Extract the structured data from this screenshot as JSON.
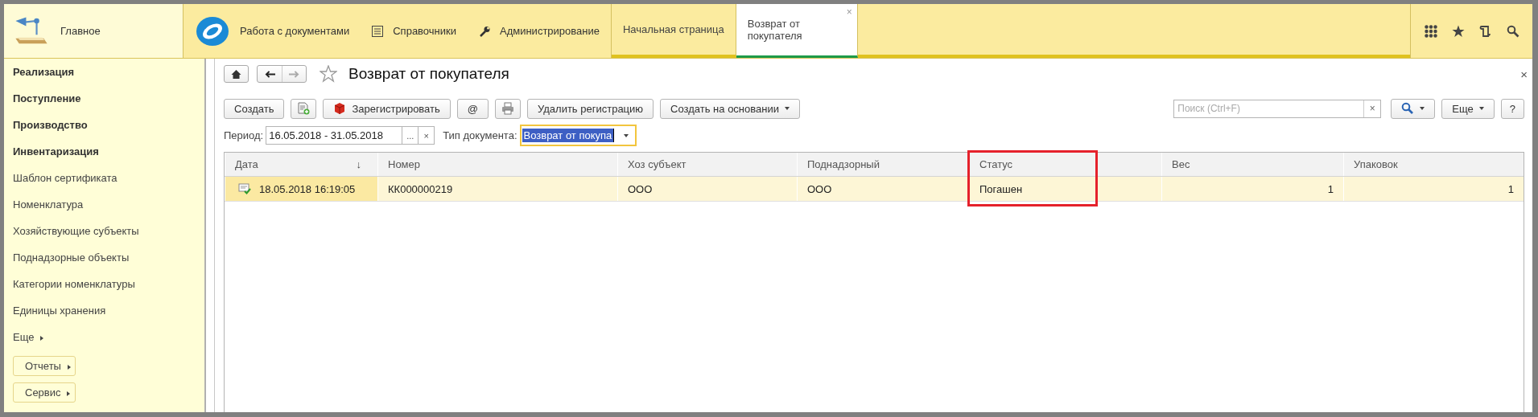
{
  "top_bar": {
    "home": {
      "label": "Главное"
    },
    "sections": [
      {
        "kind": "logo",
        "label": "Работа с документами"
      },
      {
        "kind": "list",
        "label": "Справочники"
      },
      {
        "kind": "wrench",
        "label": "Администрирование"
      }
    ],
    "open_tabs": [
      {
        "label": "Начальная страница",
        "selected": false
      },
      {
        "label": "Возврат от покупателя",
        "selected": true,
        "close": "×"
      }
    ]
  },
  "sidebar": {
    "items": [
      {
        "kind": "section",
        "label": "Реализация"
      },
      {
        "kind": "section",
        "label": "Поступление"
      },
      {
        "kind": "section",
        "label": "Производство"
      },
      {
        "kind": "section",
        "label": "Инвентаризация"
      },
      {
        "kind": "command",
        "label": "Шаблон сертификата"
      },
      {
        "kind": "command",
        "label": "Номенклатура"
      },
      {
        "kind": "command",
        "label": "Хозяйствующие субъекты"
      },
      {
        "kind": "command",
        "label": "Поднадзорные объекты"
      },
      {
        "kind": "command",
        "label": "Категории номенклатуры"
      },
      {
        "kind": "command",
        "label": "Единицы хранения"
      },
      {
        "kind": "more",
        "label": "Еще"
      }
    ],
    "buttons": [
      "Отчеты",
      "Сервис"
    ]
  },
  "form": {
    "title": "Возврат от покупателя",
    "close": "×",
    "toolbar": [
      {
        "kind": "text",
        "label": "Создать"
      },
      {
        "kind": "add-doc"
      },
      {
        "kind": "cube",
        "label": "Зарегистрировать"
      },
      {
        "kind": "text",
        "label": "@"
      },
      {
        "kind": "printer"
      },
      {
        "kind": "text",
        "label": "Удалить регистрацию"
      },
      {
        "kind": "menu",
        "label": "Создать на основании"
      }
    ],
    "search": {
      "placeholder": "Поиск (Ctrl+F)",
      "clear": "×"
    },
    "more_button": "Еще",
    "help_button": "?",
    "period": {
      "label": "Период:",
      "value": "16.05.2018 - 31.05.2018",
      "pick": "...",
      "clear": "×"
    },
    "doc_type": {
      "label": "Тип документа:",
      "value": "Возврат от покупа"
    },
    "table": {
      "columns": [
        {
          "label": "Дата",
          "sort": "↓"
        },
        {
          "label": "Номер"
        },
        {
          "label": "Хоз субъект"
        },
        {
          "label": "Поднадзорный"
        },
        {
          "label": "Статус"
        },
        {
          "label": "Вес"
        },
        {
          "label": "Упаковок"
        }
      ],
      "rows": [
        {
          "selected": true,
          "cells": [
            "18.05.2018 16:19:05",
            "КК000000219",
            "ООО",
            "ООО",
            "Погашен",
            "1",
            "1"
          ]
        }
      ]
    }
  }
}
